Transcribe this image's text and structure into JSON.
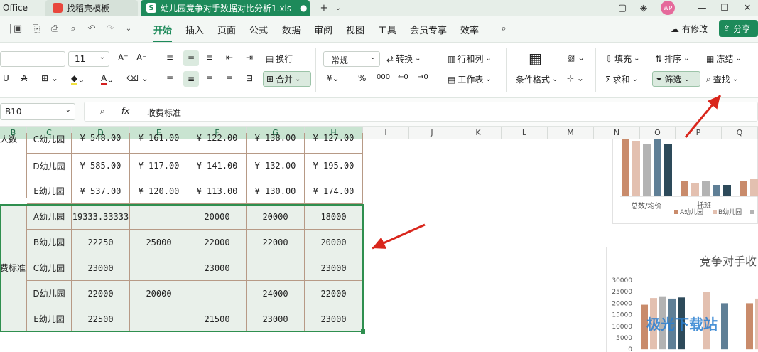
{
  "titlebar": {
    "office_tab": "Office",
    "template_tab": "找稻壳模板",
    "file_tab": "幼儿园竞争对手数据对比分析1.xls",
    "user_badge": "WP"
  },
  "menubar": {
    "items": [
      "开始",
      "插入",
      "页面",
      "公式",
      "数据",
      "审阅",
      "视图",
      "工具",
      "会员专享",
      "效率"
    ],
    "active": "开始",
    "modify_label": "有修改",
    "share_label": "分享"
  },
  "ribbon": {
    "font_size": "11",
    "wrap_label": "换行",
    "number_format": "常规",
    "convert_label": "转换",
    "rowcol_label": "行和列",
    "worksheet_label": "工作表",
    "merge_label": "合并",
    "cond_format_label": "条件格式",
    "fill_label": "填充",
    "sort_label": "排序",
    "freeze_label": "冻结",
    "sum_label": "求和",
    "filter_label": "筛选",
    "find_label": "查找",
    "currency_symbol": "¥",
    "percent_symbol": "%"
  },
  "formula_bar": {
    "cell_ref": "B10",
    "fx": "fx",
    "content": "收费标准"
  },
  "columns": [
    "B",
    "C",
    "D",
    "E",
    "F",
    "G",
    "H",
    "I",
    "J",
    "K",
    "L",
    "M",
    "N",
    "O",
    "P",
    "Q"
  ],
  "grid": {
    "side_label_top": "人数",
    "side_label_fee": "费标准",
    "top_rows": [
      {
        "name": "C幼儿园",
        "values": [
          "¥ 548.00",
          "¥ 161.00",
          "¥ 122.00",
          "¥ 138.00",
          "¥ 127.00"
        ]
      },
      {
        "name": "D幼儿园",
        "values": [
          "¥ 585.00",
          "¥ 117.00",
          "¥ 141.00",
          "¥ 132.00",
          "¥ 195.00"
        ]
      },
      {
        "name": "E幼儿园",
        "values": [
          "¥ 537.00",
          "¥ 120.00",
          "¥ 113.00",
          "¥ 130.00",
          "¥ 174.00"
        ]
      }
    ],
    "fee_rows": [
      {
        "name": "A幼儿园",
        "values": [
          "19333.33333",
          "",
          "20000",
          "20000",
          "18000"
        ]
      },
      {
        "name": "B幼儿园",
        "values": [
          "22250",
          "25000",
          "22000",
          "22000",
          "20000"
        ]
      },
      {
        "name": "C幼儿园",
        "values": [
          "23000",
          "",
          "23000",
          "",
          "23000"
        ]
      },
      {
        "name": "D幼儿园",
        "values": [
          "22000",
          "20000",
          "",
          "24000",
          "22000"
        ]
      },
      {
        "name": "E幼儿园",
        "values": [
          "22500",
          "",
          "21500",
          "23000",
          "23000"
        ]
      }
    ]
  },
  "chart1": {
    "x_labels": [
      "总数/均价",
      "托班"
    ],
    "legend": [
      "A幼儿园",
      "B幼儿园"
    ]
  },
  "chart2": {
    "title": "竞争对手收",
    "y_ticks": [
      "30000",
      "25000",
      "20000",
      "15000",
      "10000",
      "5000",
      "0"
    ]
  },
  "colors": {
    "accent": "#1d8a5a",
    "arrow": "#d9261c",
    "bar_colors": [
      "#c98b6b",
      "#e3c0b0",
      "#b3b3b3",
      "#5f7f96",
      "#2d4a5a"
    ]
  }
}
